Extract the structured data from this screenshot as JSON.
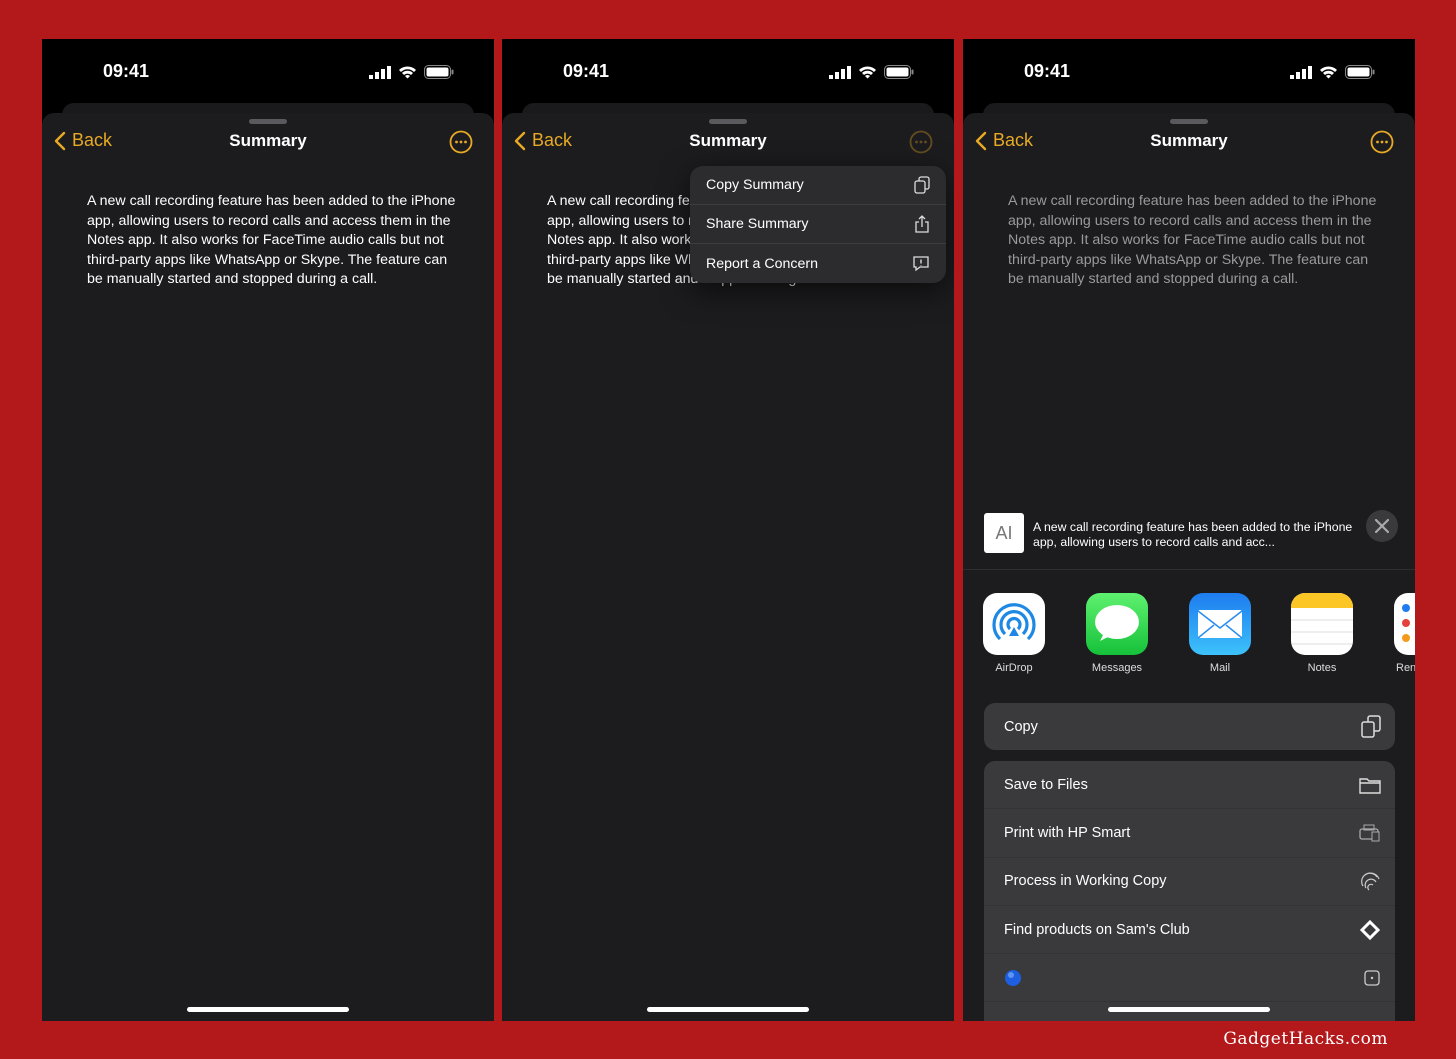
{
  "status": {
    "time": "09:41"
  },
  "nav": {
    "back": "Back",
    "title": "Summary"
  },
  "summary": "A new call recording feature has been added to the iPhone app, allowing users to record calls and access them in the Notes app. It also works for FaceTime audio calls but not third-party apps like WhatsApp or Skype. The feature can be manually started and stopped during a call.",
  "menu": [
    {
      "label": "Copy Summary",
      "icon": "copy-icon"
    },
    {
      "label": "Share Summary",
      "icon": "share-icon"
    },
    {
      "label": "Report a Concern",
      "icon": "report-icon"
    }
  ],
  "share": {
    "preview_icon": "AI",
    "preview_text": "A new call recording feature has been added to the iPhone app, allowing users to record calls and acc...",
    "apps": [
      {
        "label": "AirDrop"
      },
      {
        "label": "Messages"
      },
      {
        "label": "Mail"
      },
      {
        "label": "Notes"
      },
      {
        "label": "Ren"
      }
    ],
    "copy": "Copy",
    "actions": [
      {
        "label": "Save to Files",
        "icon": "folder-icon"
      },
      {
        "label": "Print with HP Smart",
        "icon": "printer-icon"
      },
      {
        "label": "Process in Working Copy",
        "icon": "fingerprint-icon"
      },
      {
        "label": "Find products on Sam's Club",
        "icon": "diamond-icon"
      },
      {
        "label": "",
        "icon": "square-dot-icon"
      }
    ]
  },
  "colors": {
    "accent": "#e8a924",
    "frame": "#b3181b"
  },
  "watermark": "GadgetHacks.com"
}
